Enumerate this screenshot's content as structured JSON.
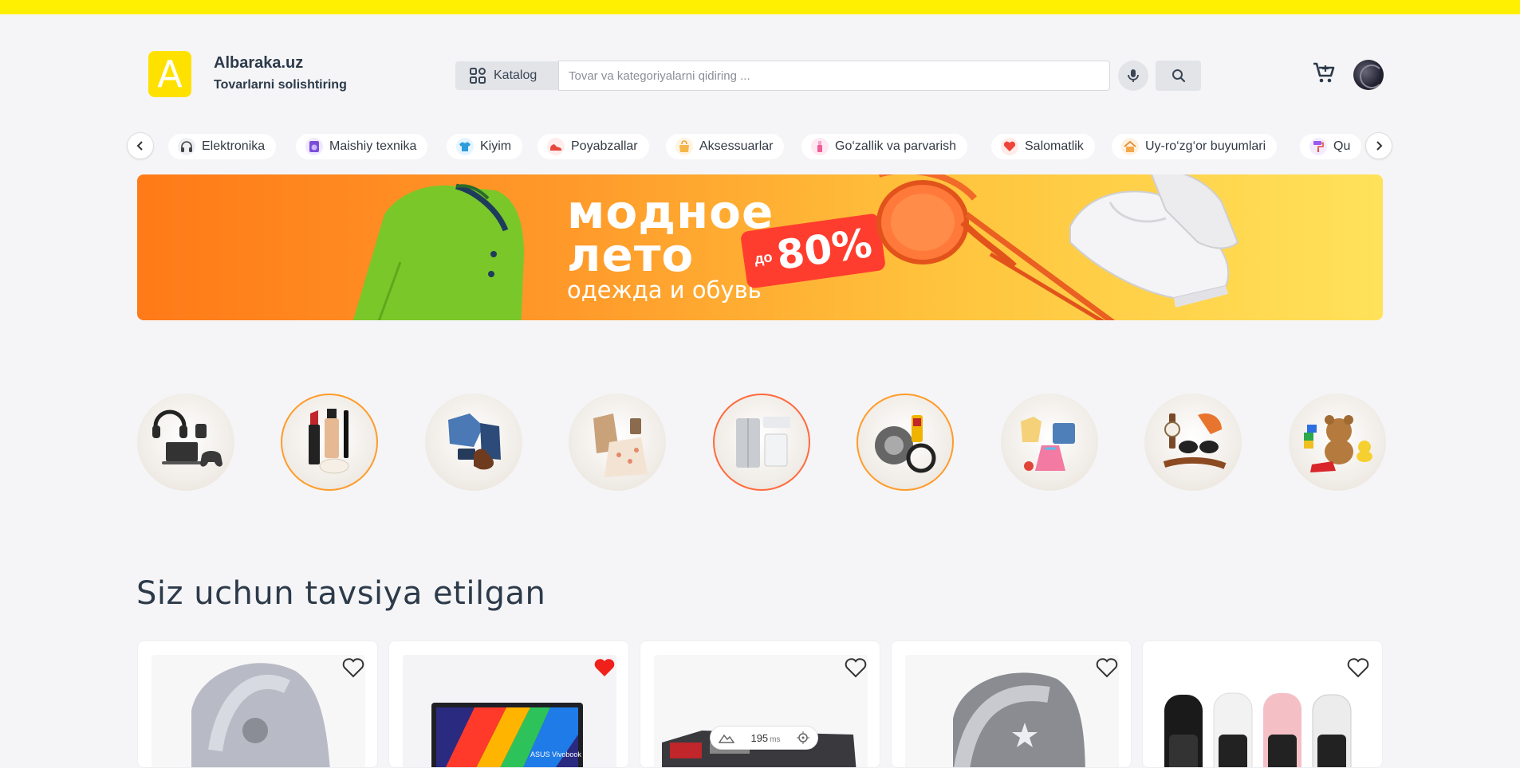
{
  "header": {
    "logo_letter": "A",
    "brand_name": "Albaraka.uz",
    "brand_tagline": "Tovarlarni solishtiring",
    "catalog_label": "Katalog",
    "search_placeholder": "Tovar va kategoriyalarni qidiring ...",
    "accent_color": "#ffef00"
  },
  "categories": [
    {
      "label": "Elektronika",
      "icon": "headphones-icon"
    },
    {
      "label": "Maishiy texnika",
      "icon": "appliance-icon"
    },
    {
      "label": "Kiyim",
      "icon": "shirt-icon"
    },
    {
      "label": "Poyabzallar",
      "icon": "shoe-icon"
    },
    {
      "label": "Aksessuarlar",
      "icon": "bag-icon"
    },
    {
      "label": "Go‘zallik va parvarish",
      "icon": "cosmetics-icon"
    },
    {
      "label": "Salomatlik",
      "icon": "heart-icon"
    },
    {
      "label": "Uy-ro‘zg‘or buyumlari",
      "icon": "house-icon"
    },
    {
      "label": "Qu",
      "icon": "paint-roller-icon"
    }
  ],
  "banner": {
    "line1": "модное",
    "line2": "лето",
    "subtitle": "одежда и обувь",
    "badge_prefix": "до",
    "badge_value": "80%"
  },
  "category_circles": [
    "electronics-image",
    "cosmetics-image",
    "clothing-image",
    "womens-clothing-image",
    "appliances-image",
    "auto-parts-image",
    "kids-clothing-image",
    "accessories-image",
    "toys-image"
  ],
  "section": {
    "title": "Siz uchun tavsiya etilgan"
  },
  "products": [
    {
      "name": "stroller-mosquito-net",
      "favorited": false
    },
    {
      "name": "asus-vivobook-laptop",
      "favorited": true
    },
    {
      "name": "boxed-product",
      "favorited": false
    },
    {
      "name": "stroller-mosquito-net-gray",
      "favorited": false
    },
    {
      "name": "smart-band-straps",
      "favorited": false
    }
  ],
  "perf_overlay": {
    "value": "195",
    "unit": "ms"
  }
}
